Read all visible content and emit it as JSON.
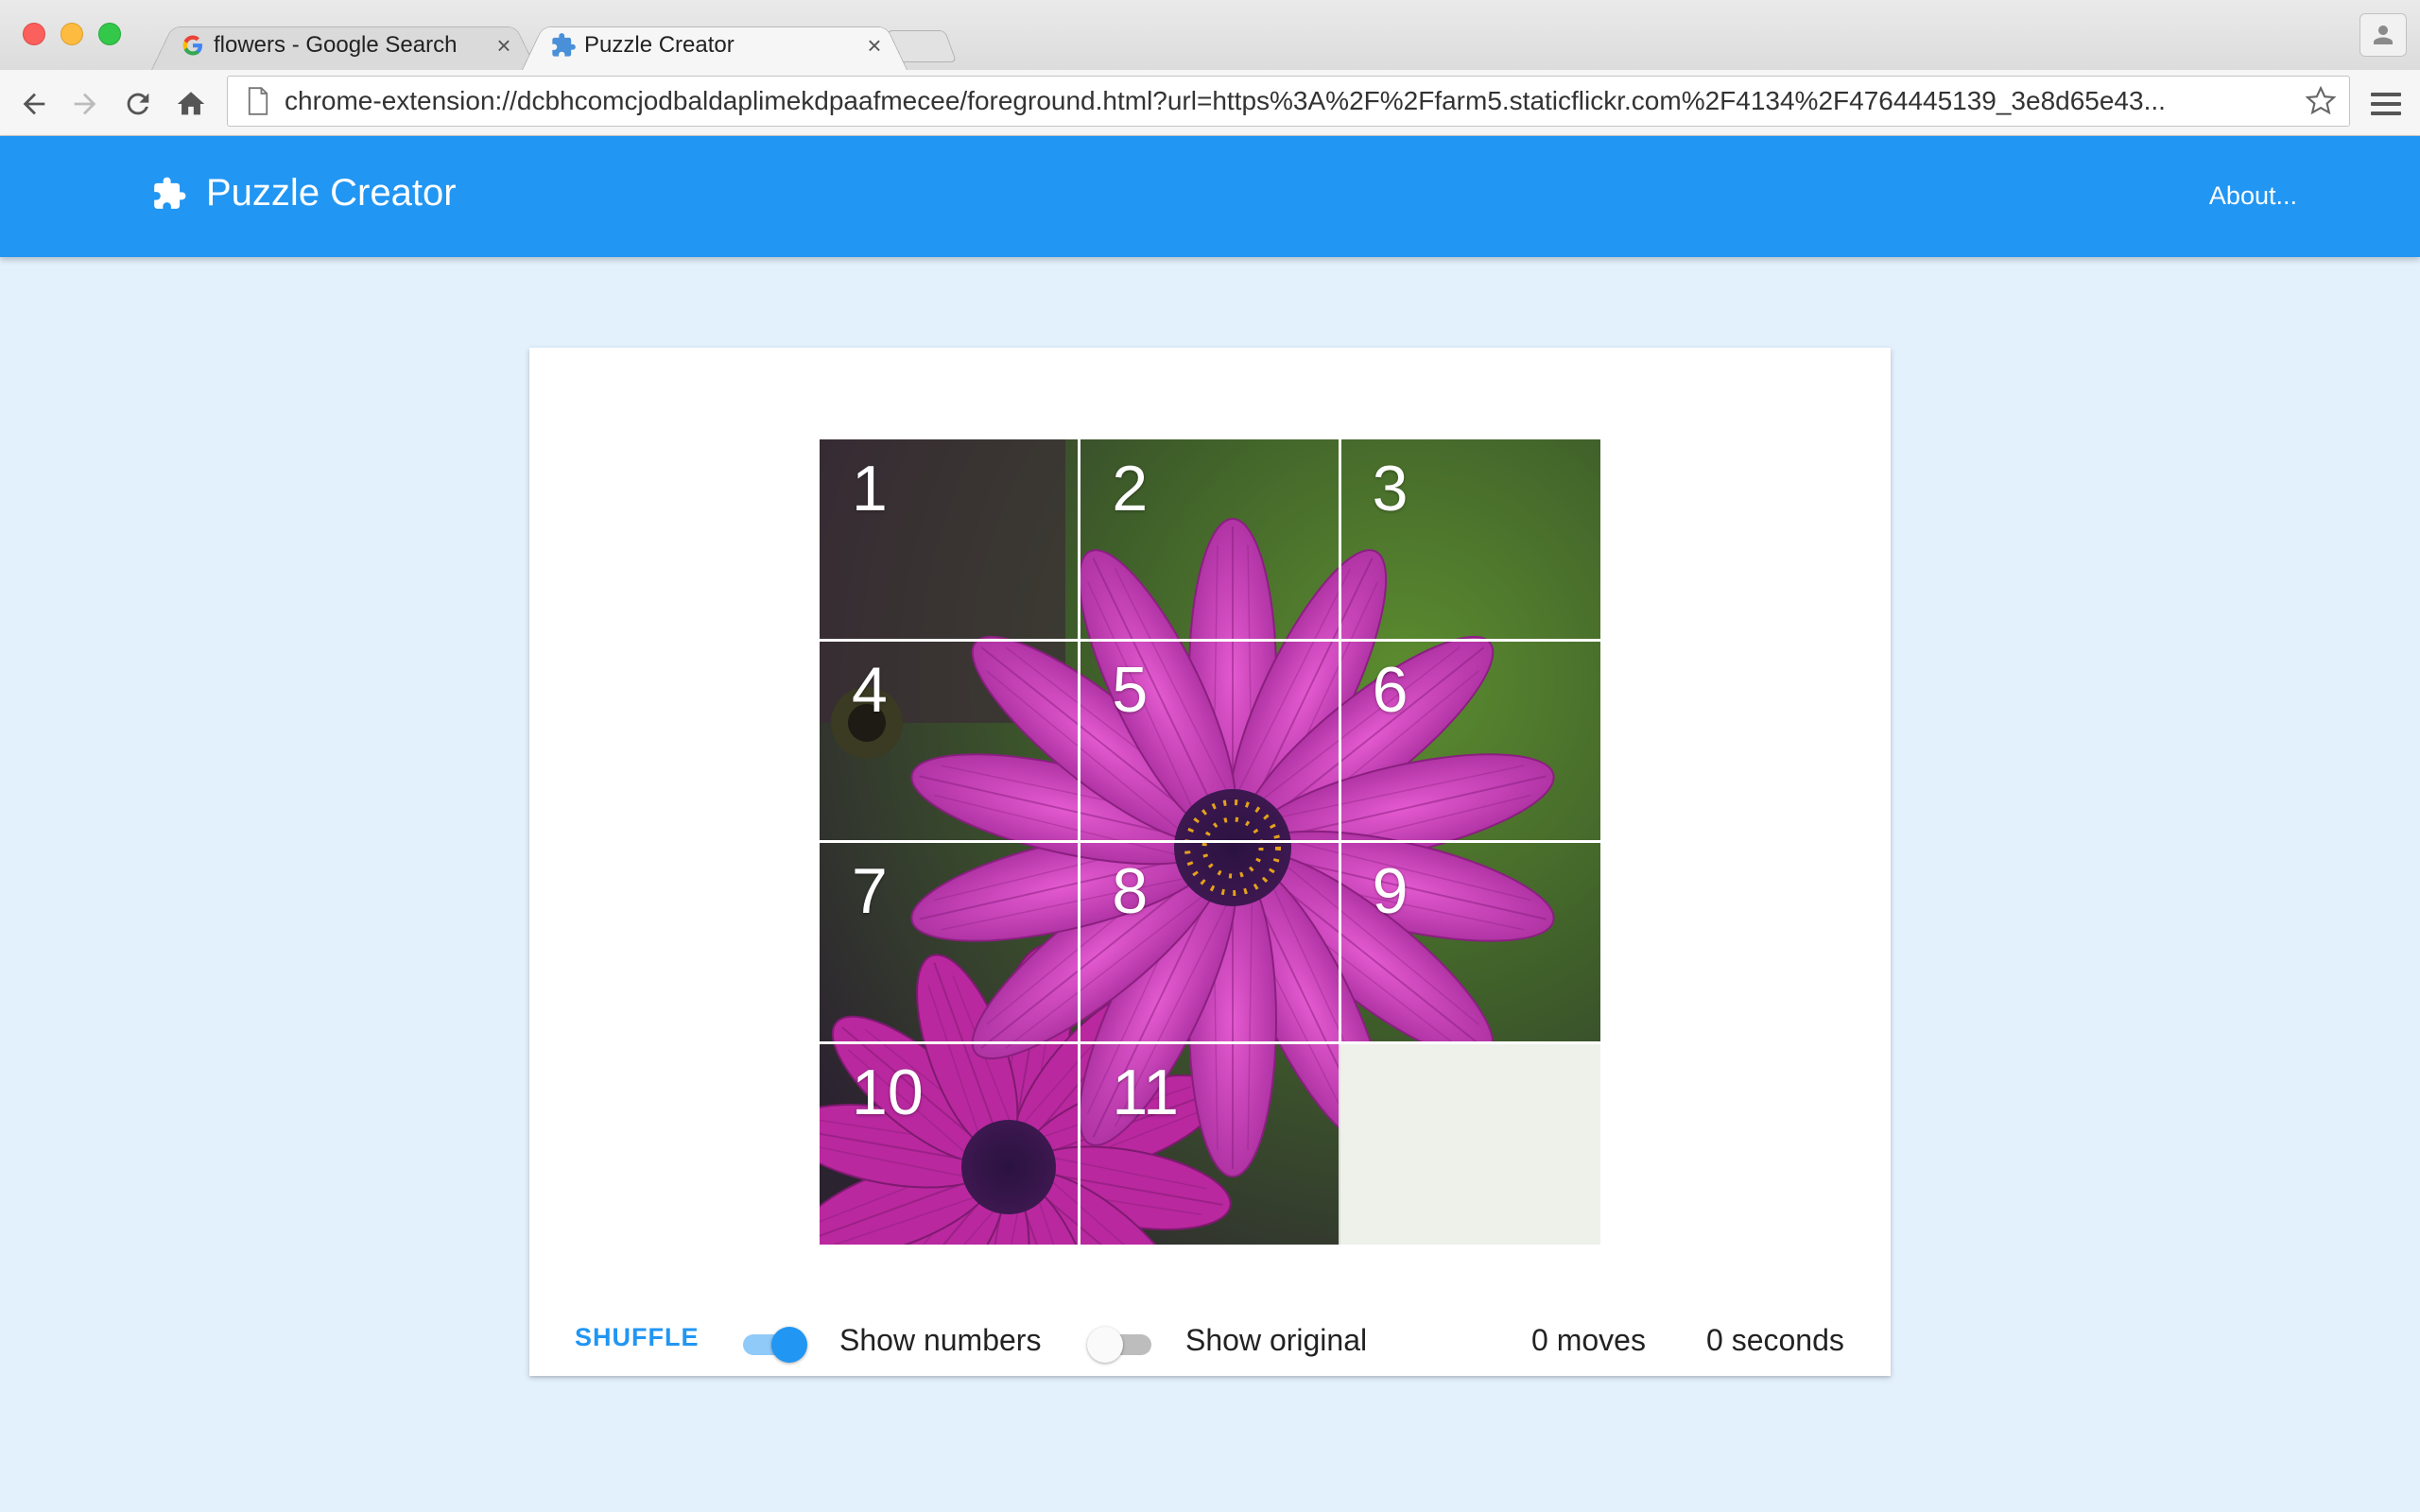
{
  "browser": {
    "tabs": [
      {
        "title": "flowers - Google Search",
        "icon": "google-icon",
        "active": false
      },
      {
        "title": "Puzzle Creator",
        "icon": "puzzle-piece-icon",
        "active": true
      }
    ],
    "url": "chrome-extension://dcbhcomcjodbaldaplimekdpaafmecee/foreground.html?url=https%3A%2F%2Ffarm5.staticflickr.com%2F4134%2F4764445139_3e8d65e43..."
  },
  "app": {
    "title": "Puzzle Creator",
    "about_label": "About...",
    "brand_color": "#2196f3",
    "background_color": "#e3f1fd"
  },
  "puzzle": {
    "rows": 4,
    "cols": 3,
    "tiles": [
      "1",
      "2",
      "3",
      "4",
      "5",
      "6",
      "7",
      "8",
      "9",
      "10",
      "11"
    ],
    "empty_tile": 12,
    "image_subject": "purple daisy flower"
  },
  "controls": {
    "shuffle_label": "SHUFFLE",
    "show_numbers_label": "Show numbers",
    "show_numbers_on": true,
    "show_original_label": "Show original",
    "show_original_on": false,
    "moves": "0 moves",
    "seconds": "0 seconds"
  }
}
